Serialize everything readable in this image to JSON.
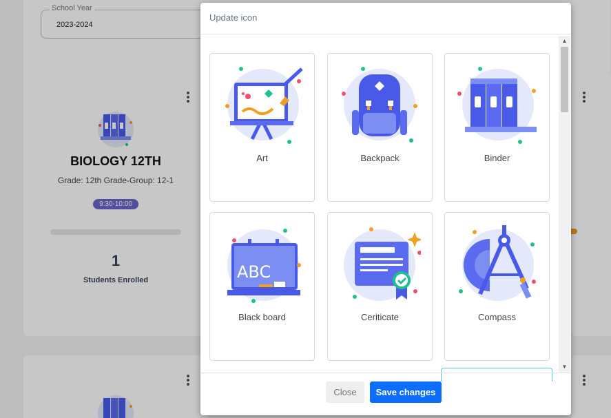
{
  "background": {
    "school_year": {
      "label": "School Year",
      "value": "2023-2024"
    },
    "class_card": {
      "title": "BIOLOGY 12TH",
      "grade": "Grade: 12th Grade-Group: 12-1",
      "time": "9:30-10:00",
      "students_count": "1",
      "students_label": "Students Enrolled"
    }
  },
  "modal": {
    "title": "Update icon",
    "icons": [
      {
        "label": "Art",
        "icon": "art-easel-icon"
      },
      {
        "label": "Backpack",
        "icon": "backpack-icon"
      },
      {
        "label": "Binder",
        "icon": "binder-icon"
      },
      {
        "label": "Black board",
        "icon": "blackboard-icon"
      },
      {
        "label": "Ceriticate",
        "icon": "certificate-icon"
      },
      {
        "label": "Compass",
        "icon": "compass-icon"
      }
    ],
    "buttons": {
      "close": "Close",
      "save": "Save changes"
    }
  },
  "colors": {
    "accent": "#0d6efd",
    "icon_primary": "#4a5ae8",
    "icon_bg": "#e3e9fb",
    "badge": "#6b65c8"
  }
}
